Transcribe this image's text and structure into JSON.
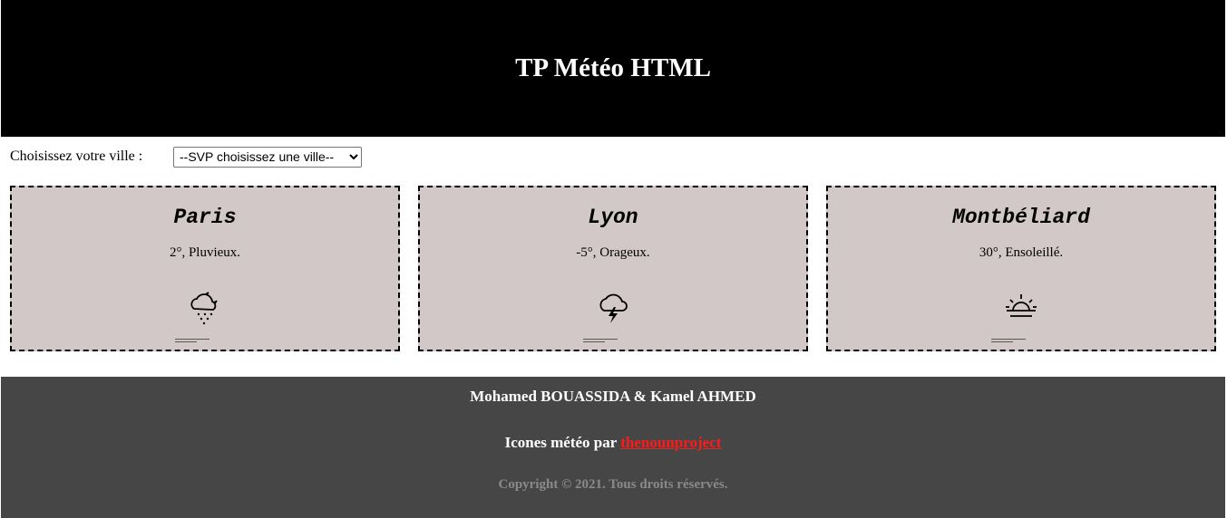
{
  "header": {
    "title": "TP Météo HTML"
  },
  "city_selector": {
    "label": "Choisissez votre ville :",
    "selected": "--SVP choisissez une ville--"
  },
  "cards": [
    {
      "city": "Paris",
      "weather": "2°, Pluvieux.",
      "icon": "cloud-moon-snow-icon"
    },
    {
      "city": "Lyon",
      "weather": "-5°, Orageux.",
      "icon": "storm-icon"
    },
    {
      "city": "Montbéliard",
      "weather": "30°, Ensoleillé.",
      "icon": "sunrise-icon"
    }
  ],
  "footer": {
    "authors": "Mohamed BOUASSIDA & Kamel AHMED",
    "icons_prefix": "Icones météo par",
    "icons_link": "thenounproject",
    "copyright": "Copyright © 2021. Tous droits réservés."
  },
  "colors": {
    "header_bg": "#000000",
    "card_bg": "#d3c8c8",
    "footer_bg": "#464646",
    "link": "#ff1a1a"
  }
}
